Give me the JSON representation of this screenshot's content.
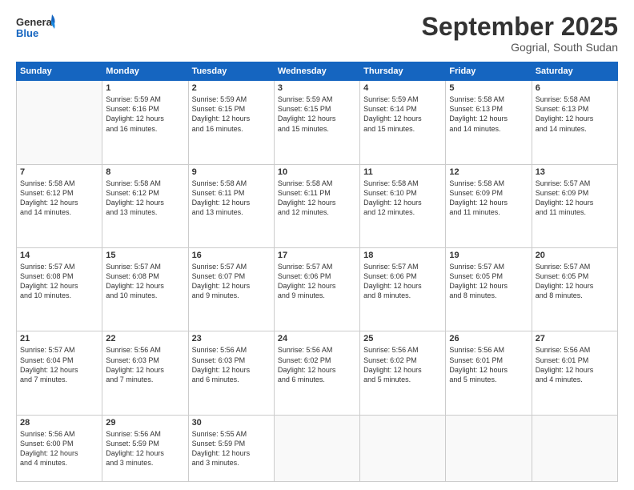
{
  "logo": {
    "line1": "General",
    "line2": "Blue"
  },
  "title": "September 2025",
  "subtitle": "Gogrial, South Sudan",
  "days_header": [
    "Sunday",
    "Monday",
    "Tuesday",
    "Wednesday",
    "Thursday",
    "Friday",
    "Saturday"
  ],
  "weeks": [
    [
      {
        "num": "",
        "info": ""
      },
      {
        "num": "1",
        "info": "Sunrise: 5:59 AM\nSunset: 6:16 PM\nDaylight: 12 hours\nand 16 minutes."
      },
      {
        "num": "2",
        "info": "Sunrise: 5:59 AM\nSunset: 6:15 PM\nDaylight: 12 hours\nand 16 minutes."
      },
      {
        "num": "3",
        "info": "Sunrise: 5:59 AM\nSunset: 6:15 PM\nDaylight: 12 hours\nand 15 minutes."
      },
      {
        "num": "4",
        "info": "Sunrise: 5:59 AM\nSunset: 6:14 PM\nDaylight: 12 hours\nand 15 minutes."
      },
      {
        "num": "5",
        "info": "Sunrise: 5:58 AM\nSunset: 6:13 PM\nDaylight: 12 hours\nand 14 minutes."
      },
      {
        "num": "6",
        "info": "Sunrise: 5:58 AM\nSunset: 6:13 PM\nDaylight: 12 hours\nand 14 minutes."
      }
    ],
    [
      {
        "num": "7",
        "info": "Sunrise: 5:58 AM\nSunset: 6:12 PM\nDaylight: 12 hours\nand 14 minutes."
      },
      {
        "num": "8",
        "info": "Sunrise: 5:58 AM\nSunset: 6:12 PM\nDaylight: 12 hours\nand 13 minutes."
      },
      {
        "num": "9",
        "info": "Sunrise: 5:58 AM\nSunset: 6:11 PM\nDaylight: 12 hours\nand 13 minutes."
      },
      {
        "num": "10",
        "info": "Sunrise: 5:58 AM\nSunset: 6:11 PM\nDaylight: 12 hours\nand 12 minutes."
      },
      {
        "num": "11",
        "info": "Sunrise: 5:58 AM\nSunset: 6:10 PM\nDaylight: 12 hours\nand 12 minutes."
      },
      {
        "num": "12",
        "info": "Sunrise: 5:58 AM\nSunset: 6:09 PM\nDaylight: 12 hours\nand 11 minutes."
      },
      {
        "num": "13",
        "info": "Sunrise: 5:57 AM\nSunset: 6:09 PM\nDaylight: 12 hours\nand 11 minutes."
      }
    ],
    [
      {
        "num": "14",
        "info": "Sunrise: 5:57 AM\nSunset: 6:08 PM\nDaylight: 12 hours\nand 10 minutes."
      },
      {
        "num": "15",
        "info": "Sunrise: 5:57 AM\nSunset: 6:08 PM\nDaylight: 12 hours\nand 10 minutes."
      },
      {
        "num": "16",
        "info": "Sunrise: 5:57 AM\nSunset: 6:07 PM\nDaylight: 12 hours\nand 9 minutes."
      },
      {
        "num": "17",
        "info": "Sunrise: 5:57 AM\nSunset: 6:06 PM\nDaylight: 12 hours\nand 9 minutes."
      },
      {
        "num": "18",
        "info": "Sunrise: 5:57 AM\nSunset: 6:06 PM\nDaylight: 12 hours\nand 8 minutes."
      },
      {
        "num": "19",
        "info": "Sunrise: 5:57 AM\nSunset: 6:05 PM\nDaylight: 12 hours\nand 8 minutes."
      },
      {
        "num": "20",
        "info": "Sunrise: 5:57 AM\nSunset: 6:05 PM\nDaylight: 12 hours\nand 8 minutes."
      }
    ],
    [
      {
        "num": "21",
        "info": "Sunrise: 5:57 AM\nSunset: 6:04 PM\nDaylight: 12 hours\nand 7 minutes."
      },
      {
        "num": "22",
        "info": "Sunrise: 5:56 AM\nSunset: 6:03 PM\nDaylight: 12 hours\nand 7 minutes."
      },
      {
        "num": "23",
        "info": "Sunrise: 5:56 AM\nSunset: 6:03 PM\nDaylight: 12 hours\nand 6 minutes."
      },
      {
        "num": "24",
        "info": "Sunrise: 5:56 AM\nSunset: 6:02 PM\nDaylight: 12 hours\nand 6 minutes."
      },
      {
        "num": "25",
        "info": "Sunrise: 5:56 AM\nSunset: 6:02 PM\nDaylight: 12 hours\nand 5 minutes."
      },
      {
        "num": "26",
        "info": "Sunrise: 5:56 AM\nSunset: 6:01 PM\nDaylight: 12 hours\nand 5 minutes."
      },
      {
        "num": "27",
        "info": "Sunrise: 5:56 AM\nSunset: 6:01 PM\nDaylight: 12 hours\nand 4 minutes."
      }
    ],
    [
      {
        "num": "28",
        "info": "Sunrise: 5:56 AM\nSunset: 6:00 PM\nDaylight: 12 hours\nand 4 minutes."
      },
      {
        "num": "29",
        "info": "Sunrise: 5:56 AM\nSunset: 5:59 PM\nDaylight: 12 hours\nand 3 minutes."
      },
      {
        "num": "30",
        "info": "Sunrise: 5:55 AM\nSunset: 5:59 PM\nDaylight: 12 hours\nand 3 minutes."
      },
      {
        "num": "",
        "info": ""
      },
      {
        "num": "",
        "info": ""
      },
      {
        "num": "",
        "info": ""
      },
      {
        "num": "",
        "info": ""
      }
    ]
  ]
}
